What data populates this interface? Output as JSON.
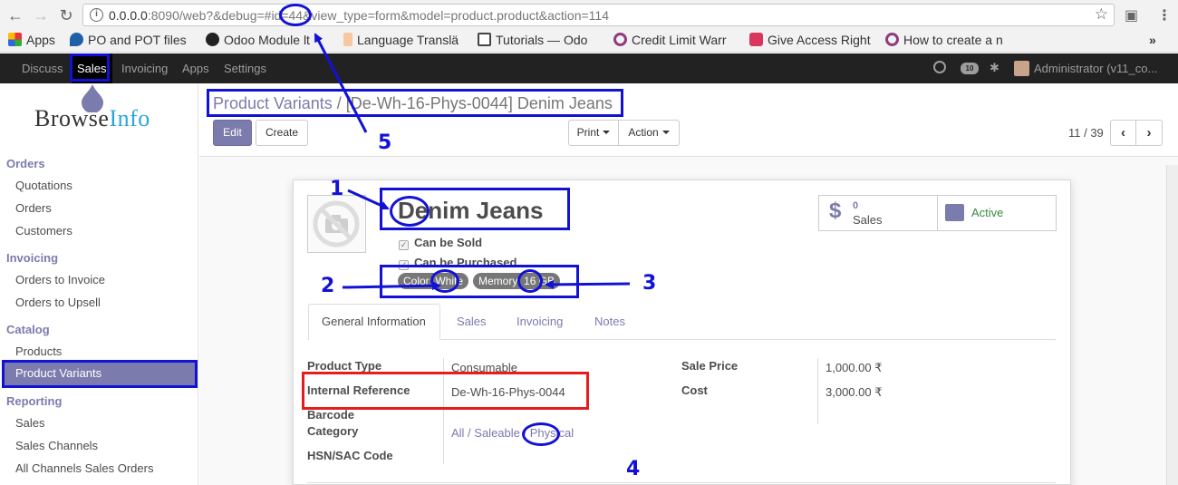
{
  "browser": {
    "url_host": "0.0.0.0",
    "url_rest": ":8090/web?&debug=#id=44&view_type=form&model=product.product&action=114",
    "info_glyph": "i"
  },
  "bookmarks": [
    {
      "label": "Apps"
    },
    {
      "label": "PO and POT files"
    },
    {
      "label": "Odoo Module lt"
    },
    {
      "label": "Language Translä"
    },
    {
      "label": "Tutorials — Odo"
    },
    {
      "label": "Credit Limit Warr"
    },
    {
      "label": "Give Access Right"
    },
    {
      "label": "How to create a n"
    }
  ],
  "topnav": {
    "items": [
      "Discuss",
      "Sales",
      "Invoicing",
      "Apps",
      "Settings"
    ],
    "active": "Sales",
    "messages_count": "10",
    "user": "Administrator (v11_co..."
  },
  "sidebar": {
    "logo_browse": "Browse",
    "logo_info": "Info",
    "sections": [
      {
        "title": "Orders",
        "items": [
          "Quotations",
          "Orders",
          "Customers"
        ]
      },
      {
        "title": "Invoicing",
        "items": [
          "Orders to Invoice",
          "Orders to Upsell"
        ]
      },
      {
        "title": "Catalog",
        "items": [
          "Products",
          "Product Variants"
        ]
      },
      {
        "title": "Reporting",
        "items": [
          "Sales",
          "Sales Channels",
          "All Channels Sales Orders"
        ]
      }
    ],
    "active_item": "Product Variants"
  },
  "control": {
    "breadcrumb_parent": "Product Variants",
    "breadcrumb_sep": " / ",
    "breadcrumb_current": "[De-Wh-16-Phys-0044] Denim Jeans",
    "edit_label": "Edit",
    "create_label": "Create",
    "print_label": "Print",
    "action_label": "Action",
    "pager": "11 / 39"
  },
  "form": {
    "name": "Denim Jeans",
    "can_be_sold": "Can be Sold",
    "can_be_purchased": "Can be Purchased",
    "tags": [
      {
        "attr": "Color",
        "value": "White"
      },
      {
        "attr": "Memory",
        "value": "16 GB"
      }
    ],
    "stat_sales_count": "0",
    "stat_sales_label": "Sales",
    "stat_active_label": "Active",
    "tabs": [
      "General Information",
      "Sales",
      "Invoicing",
      "Notes"
    ],
    "active_tab": "General Information",
    "fields_left": [
      {
        "label": "Product Type",
        "value": "Consumable"
      },
      {
        "label": "Internal Reference",
        "value": "De-Wh-16-Phys-0044"
      },
      {
        "label": "Barcode",
        "value": ""
      },
      {
        "label": "Category",
        "value": "All / Saleable / Physical"
      },
      {
        "label": "HSN/SAC Code",
        "value": ""
      }
    ],
    "fields_right": [
      {
        "label": "Sale Price",
        "value": "1,000.00 ₹"
      },
      {
        "label": "Cost",
        "value": "3,000.00 ₹"
      }
    ]
  },
  "annotations": {
    "n1": "1",
    "n2": "2",
    "n3": "3",
    "n4": "4",
    "n5": "5"
  },
  "colors": {
    "odoo_primary": "#7c7bad",
    "annotation_blue": "#1212d6",
    "annotation_red": "#e51d1d",
    "active_green": "#3b8a3e"
  }
}
